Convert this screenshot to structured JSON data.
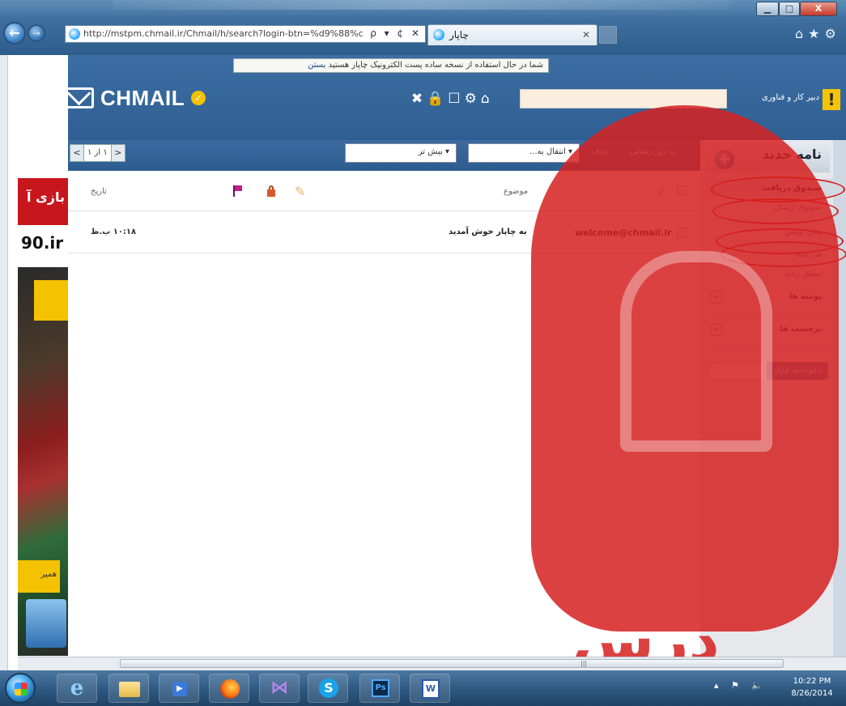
{
  "browser": {
    "address": "http://mstpm.chmail.ir/Chmail/h/search?login-btn=%d9%88%c",
    "address_tools": "ρ ▾ ¢ ✕",
    "tab_title": "چاپار",
    "tab_close": "✕",
    "win_min": "▁",
    "win_max": "□",
    "win_close": "X",
    "icons": "⌂★⚙"
  },
  "app": {
    "notice": "شما در حال استفاده از نسخه ساده پست الکترونیک چاپار هستید",
    "notice_close": "بستن",
    "logo_text": "CHMAIL",
    "logo_badge": "✓",
    "header_tools": "✖🔒☐⚙⌂",
    "user_label": "دبیر کار و فناوری",
    "user_alert": "!"
  },
  "toolbar": {
    "pager_prev": "<",
    "pager_text": "۱ از ۱",
    "pager_next": ">",
    "more_select": "▾ بیش تر",
    "move_select": "▾ انتقال به...",
    "delete": "حذف",
    "refresh": "به روز رسانی"
  },
  "ad": {
    "banner": "بازی آ",
    "domain": "90.ir",
    "bottom": "همیر"
  },
  "mail_list": {
    "col_date": "تاریخ",
    "col_subject": "موضوع",
    "col_from": "از",
    "rows": [
      {
        "date": "۱۰:۱۸ ب.ظ",
        "subject": "به چاپار خوش آمدید",
        "from": "welcome@chmail.ir"
      }
    ]
  },
  "sidebar": {
    "compose": "نامه جدید",
    "compose_icon": "+",
    "folders": [
      "صندوق دریافت",
      "صندوق ارسال",
      "پیش نویس",
      "هرزنامه",
      "سطل زباله"
    ],
    "folders_section": "پوشه ها",
    "labels_section": "برچسب ها",
    "plus": "+",
    "invite": "دعوت به چاپار"
  },
  "watermark": {
    "text": "درس"
  },
  "taskbar": {
    "media": "▶",
    "vs": "⋈",
    "skype": "S",
    "ps": "Ps",
    "word": "W",
    "tray": "▴ ⚑ 🔈",
    "time": "10:22 PM",
    "date": "8/26/2014"
  },
  "scroll": {
    "grip": "|||"
  }
}
